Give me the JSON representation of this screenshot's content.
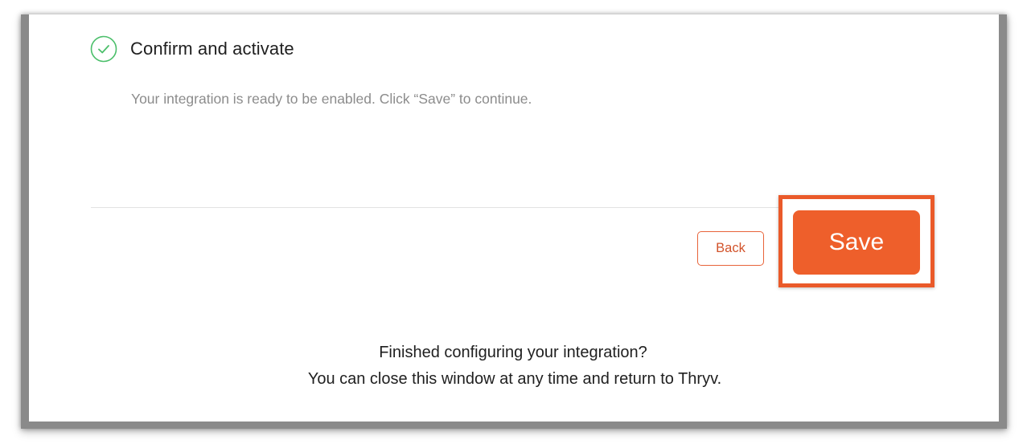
{
  "step": {
    "title": "Confirm and activate",
    "status_icon": "check-circle-icon",
    "description": "Your integration is ready to be enabled. Click “Save” to continue."
  },
  "actions": {
    "back_label": "Back",
    "save_label": "Save"
  },
  "footer": {
    "line1": "Finished configuring your integration?",
    "line2": "You can close this window at any time and return to Thryv."
  },
  "colors": {
    "accent": "#ee5f2b",
    "highlight": "#ea5a2a",
    "success": "#4cbf6b"
  }
}
